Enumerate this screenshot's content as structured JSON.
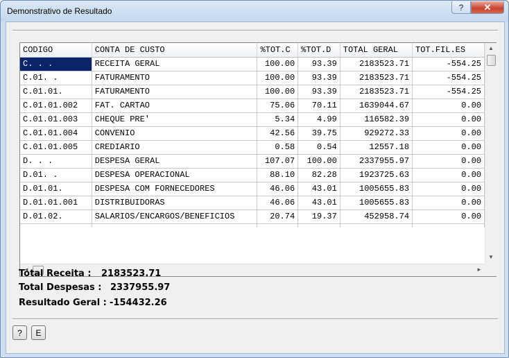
{
  "window": {
    "title": "Demonstrativo de Resultado",
    "help_button": "?",
    "close_button": "✕"
  },
  "grid": {
    "columns": [
      "CODIGO",
      "CONTA DE CUSTO",
      "%TOT.C",
      "%TOT.D",
      "TOTAL GERAL",
      "TOT.FIL.ES"
    ],
    "rows": [
      [
        "C.  .  .",
        "RECEITA GERAL",
        "100.00",
        "93.39",
        "2183523.71",
        "-554.25"
      ],
      [
        "C.01.  .",
        "FATURAMENTO",
        "100.00",
        "93.39",
        "2183523.71",
        "-554.25"
      ],
      [
        "C.01.01.",
        "FATURAMENTO",
        "100.00",
        "93.39",
        "2183523.71",
        "-554.25"
      ],
      [
        "C.01.01.002",
        "FAT. CARTAO",
        "75.06",
        "70.11",
        "1639044.67",
        "0.00"
      ],
      [
        "C.01.01.003",
        "CHEQUE PRE'",
        "5.34",
        "4.99",
        "116582.39",
        "0.00"
      ],
      [
        "C.01.01.004",
        "CONVENIO",
        "42.56",
        "39.75",
        "929272.33",
        "0.00"
      ],
      [
        "C.01.01.005",
        "CREDIARIO",
        "0.58",
        "0.54",
        "12557.18",
        "0.00"
      ],
      [
        "D.  .  .",
        "DESPESA GERAL",
        "107.07",
        "100.00",
        "2337955.97",
        "0.00"
      ],
      [
        "D.01.  .",
        "DESPESA OPERACIONAL",
        "88.10",
        "82.28",
        "1923725.63",
        "0.00"
      ],
      [
        "D.01.01.",
        "DESPESA COM FORNECEDORES",
        "46.06",
        "43.01",
        "1005655.83",
        "0.00"
      ],
      [
        "D.01.01.001",
        "DISTRIBUIDORAS",
        "46.06",
        "43.01",
        "1005655.83",
        "0.00"
      ],
      [
        "D.01.02.",
        "SALARIOS/ENCARGOS/BENEFICIOS",
        "20.74",
        "19.37",
        "452958.74",
        "0.00"
      ]
    ]
  },
  "totals": {
    "receita_label": "Total Receita  :",
    "receita_value": "2183523.71",
    "despesas_label": "Total Despesas :",
    "despesas_value": "2337955.97",
    "resultado_label": "Resultado Geral :",
    "resultado_value": "-154432.26"
  },
  "buttons": {
    "help": "?",
    "e": "E"
  },
  "scrollbar_icons": {
    "up": "▲",
    "down": "▼",
    "left": "◄",
    "right": "►"
  }
}
